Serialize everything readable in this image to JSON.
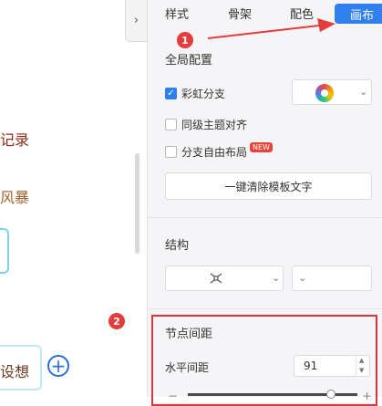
{
  "canvas": {
    "nodes": [
      "记录",
      "风暴",
      "设想"
    ],
    "collapse_glyph": "›",
    "add_glyph": "+"
  },
  "annotations": {
    "badge1": "1",
    "badge2": "2",
    "colors": {
      "badge": "#e23c3c",
      "arrow": "#e23c3c",
      "highlight": "#d9363e"
    }
  },
  "tabs": [
    {
      "label": "样式",
      "active": false
    },
    {
      "label": "骨架",
      "active": false
    },
    {
      "label": "配色",
      "active": false
    },
    {
      "label": "画布",
      "active": true
    }
  ],
  "global": {
    "title": "全局配置",
    "rainbow": {
      "label": "彩虹分支",
      "checked": true
    },
    "align": {
      "label": "同级主题对齐",
      "checked": false
    },
    "free_layout": {
      "label": "分支自由布局",
      "checked": false,
      "badge": "NEW"
    },
    "clear_button": "一键清除模板文字"
  },
  "structure": {
    "title": "结构"
  },
  "spacing": {
    "title": "节点间距",
    "horizontal": {
      "label": "水平间距",
      "value": "91"
    },
    "slider": {
      "minus": "－",
      "plus": "＋",
      "level": 0.82
    }
  },
  "accent_color": "#2f80ed"
}
